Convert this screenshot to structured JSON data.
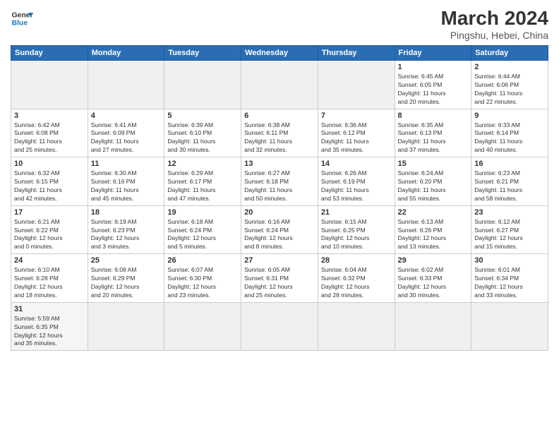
{
  "header": {
    "logo_general": "General",
    "logo_blue": "Blue",
    "month_year": "March 2024",
    "location": "Pingshu, Hebei, China"
  },
  "weekdays": [
    "Sunday",
    "Monday",
    "Tuesday",
    "Wednesday",
    "Thursday",
    "Friday",
    "Saturday"
  ],
  "weeks": [
    [
      {
        "day": "",
        "info": "",
        "empty": true
      },
      {
        "day": "",
        "info": "",
        "empty": true
      },
      {
        "day": "",
        "info": "",
        "empty": true
      },
      {
        "day": "",
        "info": "",
        "empty": true
      },
      {
        "day": "",
        "info": "",
        "empty": true
      },
      {
        "day": "1",
        "info": "Sunrise: 6:45 AM\nSunset: 6:05 PM\nDaylight: 11 hours\nand 20 minutes."
      },
      {
        "day": "2",
        "info": "Sunrise: 6:44 AM\nSunset: 6:06 PM\nDaylight: 11 hours\nand 22 minutes."
      }
    ],
    [
      {
        "day": "3",
        "info": "Sunrise: 6:42 AM\nSunset: 6:08 PM\nDaylight: 11 hours\nand 25 minutes."
      },
      {
        "day": "4",
        "info": "Sunrise: 6:41 AM\nSunset: 6:09 PM\nDaylight: 11 hours\nand 27 minutes."
      },
      {
        "day": "5",
        "info": "Sunrise: 6:39 AM\nSunset: 6:10 PM\nDaylight: 11 hours\nand 30 minutes."
      },
      {
        "day": "6",
        "info": "Sunrise: 6:38 AM\nSunset: 6:11 PM\nDaylight: 11 hours\nand 32 minutes."
      },
      {
        "day": "7",
        "info": "Sunrise: 6:36 AM\nSunset: 6:12 PM\nDaylight: 11 hours\nand 35 minutes."
      },
      {
        "day": "8",
        "info": "Sunrise: 6:35 AM\nSunset: 6:13 PM\nDaylight: 11 hours\nand 37 minutes."
      },
      {
        "day": "9",
        "info": "Sunrise: 6:33 AM\nSunset: 6:14 PM\nDaylight: 11 hours\nand 40 minutes."
      }
    ],
    [
      {
        "day": "10",
        "info": "Sunrise: 6:32 AM\nSunset: 6:15 PM\nDaylight: 11 hours\nand 42 minutes."
      },
      {
        "day": "11",
        "info": "Sunrise: 6:30 AM\nSunset: 6:16 PM\nDaylight: 11 hours\nand 45 minutes."
      },
      {
        "day": "12",
        "info": "Sunrise: 6:29 AM\nSunset: 6:17 PM\nDaylight: 11 hours\nand 47 minutes."
      },
      {
        "day": "13",
        "info": "Sunrise: 6:27 AM\nSunset: 6:18 PM\nDaylight: 11 hours\nand 50 minutes."
      },
      {
        "day": "14",
        "info": "Sunrise: 6:26 AM\nSunset: 6:19 PM\nDaylight: 11 hours\nand 53 minutes."
      },
      {
        "day": "15",
        "info": "Sunrise: 6:24 AM\nSunset: 6:20 PM\nDaylight: 11 hours\nand 55 minutes."
      },
      {
        "day": "16",
        "info": "Sunrise: 6:23 AM\nSunset: 6:21 PM\nDaylight: 11 hours\nand 58 minutes."
      }
    ],
    [
      {
        "day": "17",
        "info": "Sunrise: 6:21 AM\nSunset: 6:22 PM\nDaylight: 12 hours\nand 0 minutes."
      },
      {
        "day": "18",
        "info": "Sunrise: 6:19 AM\nSunset: 6:23 PM\nDaylight: 12 hours\nand 3 minutes."
      },
      {
        "day": "19",
        "info": "Sunrise: 6:18 AM\nSunset: 6:24 PM\nDaylight: 12 hours\nand 5 minutes."
      },
      {
        "day": "20",
        "info": "Sunrise: 6:16 AM\nSunset: 6:24 PM\nDaylight: 12 hours\nand 8 minutes."
      },
      {
        "day": "21",
        "info": "Sunrise: 6:15 AM\nSunset: 6:25 PM\nDaylight: 12 hours\nand 10 minutes."
      },
      {
        "day": "22",
        "info": "Sunrise: 6:13 AM\nSunset: 6:26 PM\nDaylight: 12 hours\nand 13 minutes."
      },
      {
        "day": "23",
        "info": "Sunrise: 6:12 AM\nSunset: 6:27 PM\nDaylight: 12 hours\nand 15 minutes."
      }
    ],
    [
      {
        "day": "24",
        "info": "Sunrise: 6:10 AM\nSunset: 6:28 PM\nDaylight: 12 hours\nand 18 minutes."
      },
      {
        "day": "25",
        "info": "Sunrise: 6:08 AM\nSunset: 6:29 PM\nDaylight: 12 hours\nand 20 minutes."
      },
      {
        "day": "26",
        "info": "Sunrise: 6:07 AM\nSunset: 6:30 PM\nDaylight: 12 hours\nand 23 minutes."
      },
      {
        "day": "27",
        "info": "Sunrise: 6:05 AM\nSunset: 6:31 PM\nDaylight: 12 hours\nand 25 minutes."
      },
      {
        "day": "28",
        "info": "Sunrise: 6:04 AM\nSunset: 6:32 PM\nDaylight: 12 hours\nand 28 minutes."
      },
      {
        "day": "29",
        "info": "Sunrise: 6:02 AM\nSunset: 6:33 PM\nDaylight: 12 hours\nand 30 minutes."
      },
      {
        "day": "30",
        "info": "Sunrise: 6:01 AM\nSunset: 6:34 PM\nDaylight: 12 hours\nand 33 minutes."
      }
    ],
    [
      {
        "day": "31",
        "info": "Sunrise: 5:59 AM\nSunset: 6:35 PM\nDaylight: 12 hours\nand 35 minutes."
      },
      {
        "day": "",
        "info": "",
        "empty": true
      },
      {
        "day": "",
        "info": "",
        "empty": true
      },
      {
        "day": "",
        "info": "",
        "empty": true
      },
      {
        "day": "",
        "info": "",
        "empty": true
      },
      {
        "day": "",
        "info": "",
        "empty": true
      },
      {
        "day": "",
        "info": "",
        "empty": true
      }
    ]
  ]
}
